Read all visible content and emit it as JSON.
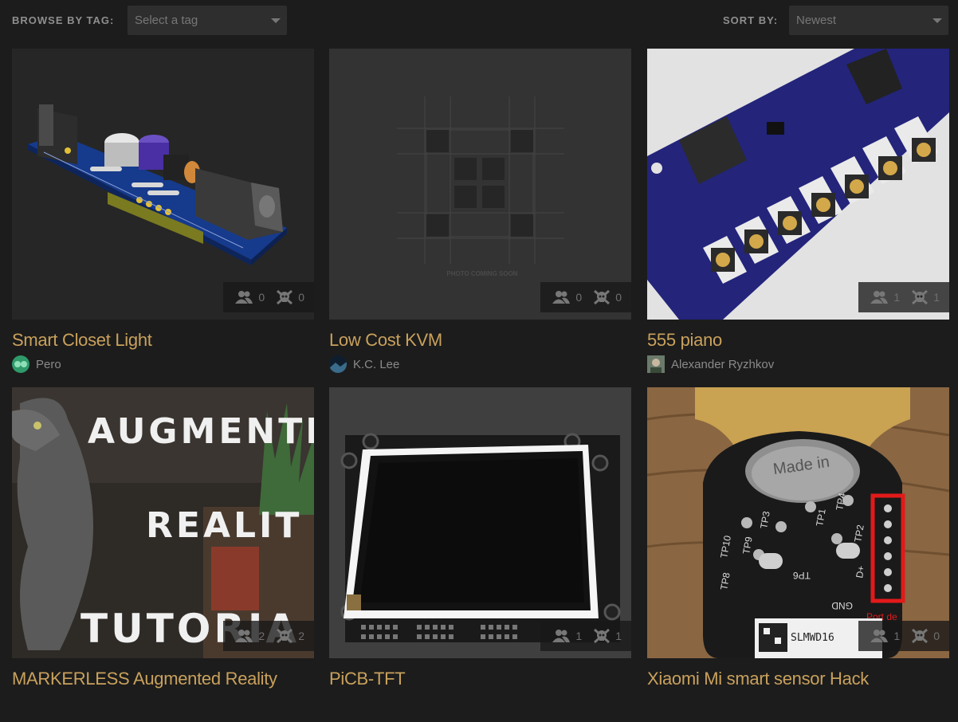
{
  "toolbar": {
    "browse_label": "BROWSE BY TAG:",
    "tag_placeholder": "Select a tag",
    "sort_label": "SORT BY:",
    "sort_value": "Newest"
  },
  "projects": [
    {
      "title": "Smart Closet Light",
      "author": "Pero",
      "followers": "0",
      "skulls": "0"
    },
    {
      "title": "Low Cost KVM",
      "author": "K.C. Lee",
      "followers": "0",
      "skulls": "0",
      "placeholder_text": "PHOTO COMING SOON"
    },
    {
      "title": "555 piano",
      "author": "Alexander Ryzhkov",
      "followers": "1",
      "skulls": "1"
    },
    {
      "title": "MARKERLESS Augmented Reality",
      "author": "",
      "followers": "2",
      "skulls": "2",
      "image_text": [
        "AUGMENTE",
        "REALIT",
        "TUTORIA"
      ]
    },
    {
      "title": "PiCB-TFT",
      "author": "",
      "followers": "1",
      "skulls": "1"
    },
    {
      "title": "Xiaomi Mi smart sensor Hack",
      "author": "",
      "followers": "1",
      "skulls": "0",
      "image_text": [
        "Made in",
        "TP4",
        "TP1",
        "TP2",
        "TP3",
        "TP10",
        "TP9",
        "TP8",
        "TP6",
        "D+",
        "GND",
        "SLMWD16",
        "Port de"
      ]
    }
  ],
  "colors": {
    "background": "#1c1c1c",
    "title": "#c9a15c",
    "control": "#2e2e2e",
    "text": "#8a8a8a"
  }
}
